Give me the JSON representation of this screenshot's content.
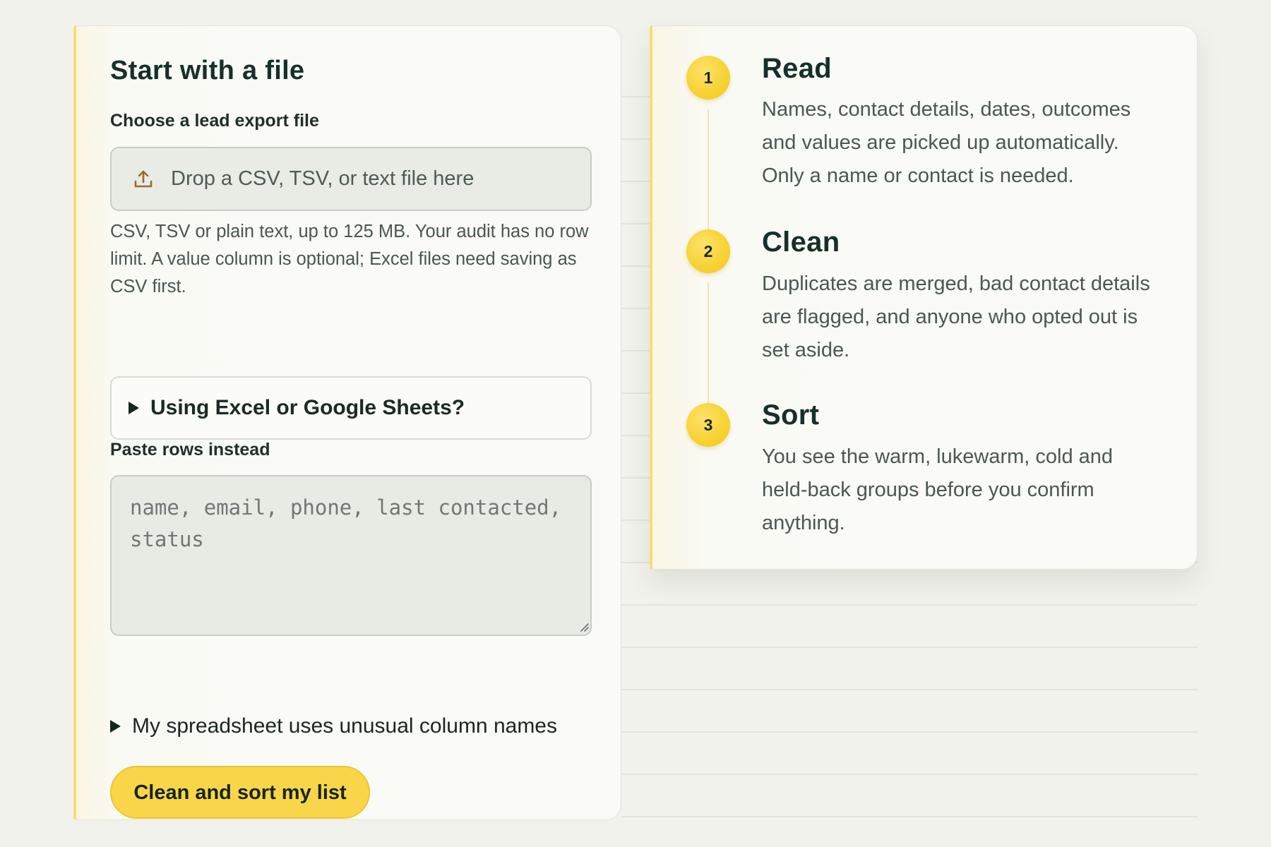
{
  "upload_card": {
    "title": "Start with a file",
    "file_label": "Choose a lead export file",
    "dropzone_text": "Drop a CSV, TSV, or text file here",
    "help_text": "CSV, TSV or plain text, up to 125 MB. Your audit has no row limit. A value column is optional; Excel files need saving as CSV first.",
    "excel_help_summary": "Using Excel or Google Sheets?",
    "paste_label": "Paste rows instead",
    "paste_placeholder": "name, email, phone, last contacted, status",
    "unusual_columns_toggle": "My spreadsheet uses unusual column names",
    "submit_label": "Clean and sort my list"
  },
  "steps": [
    {
      "number": "1",
      "title": "Read",
      "description": "Names, contact details, dates, outcomes and values are picked up automatically. Only a name or contact is needed."
    },
    {
      "number": "2",
      "title": "Clean",
      "description": "Duplicates are merged, bad contact details are flagged, and anyone who opted out is set aside."
    },
    {
      "number": "3",
      "title": "Sort",
      "description": "You see the warm, lukewarm, cold and held-back groups before you confirm anything."
    }
  ],
  "icons": {
    "upload": "upload-icon",
    "disclosure": "triangle-right-icon"
  },
  "colors": {
    "accent": "#f9d54a",
    "accent_border": "#f7dc7a",
    "text_dark": "#15302a",
    "text_muted": "#4b5752",
    "background": "#f2f2ed"
  }
}
